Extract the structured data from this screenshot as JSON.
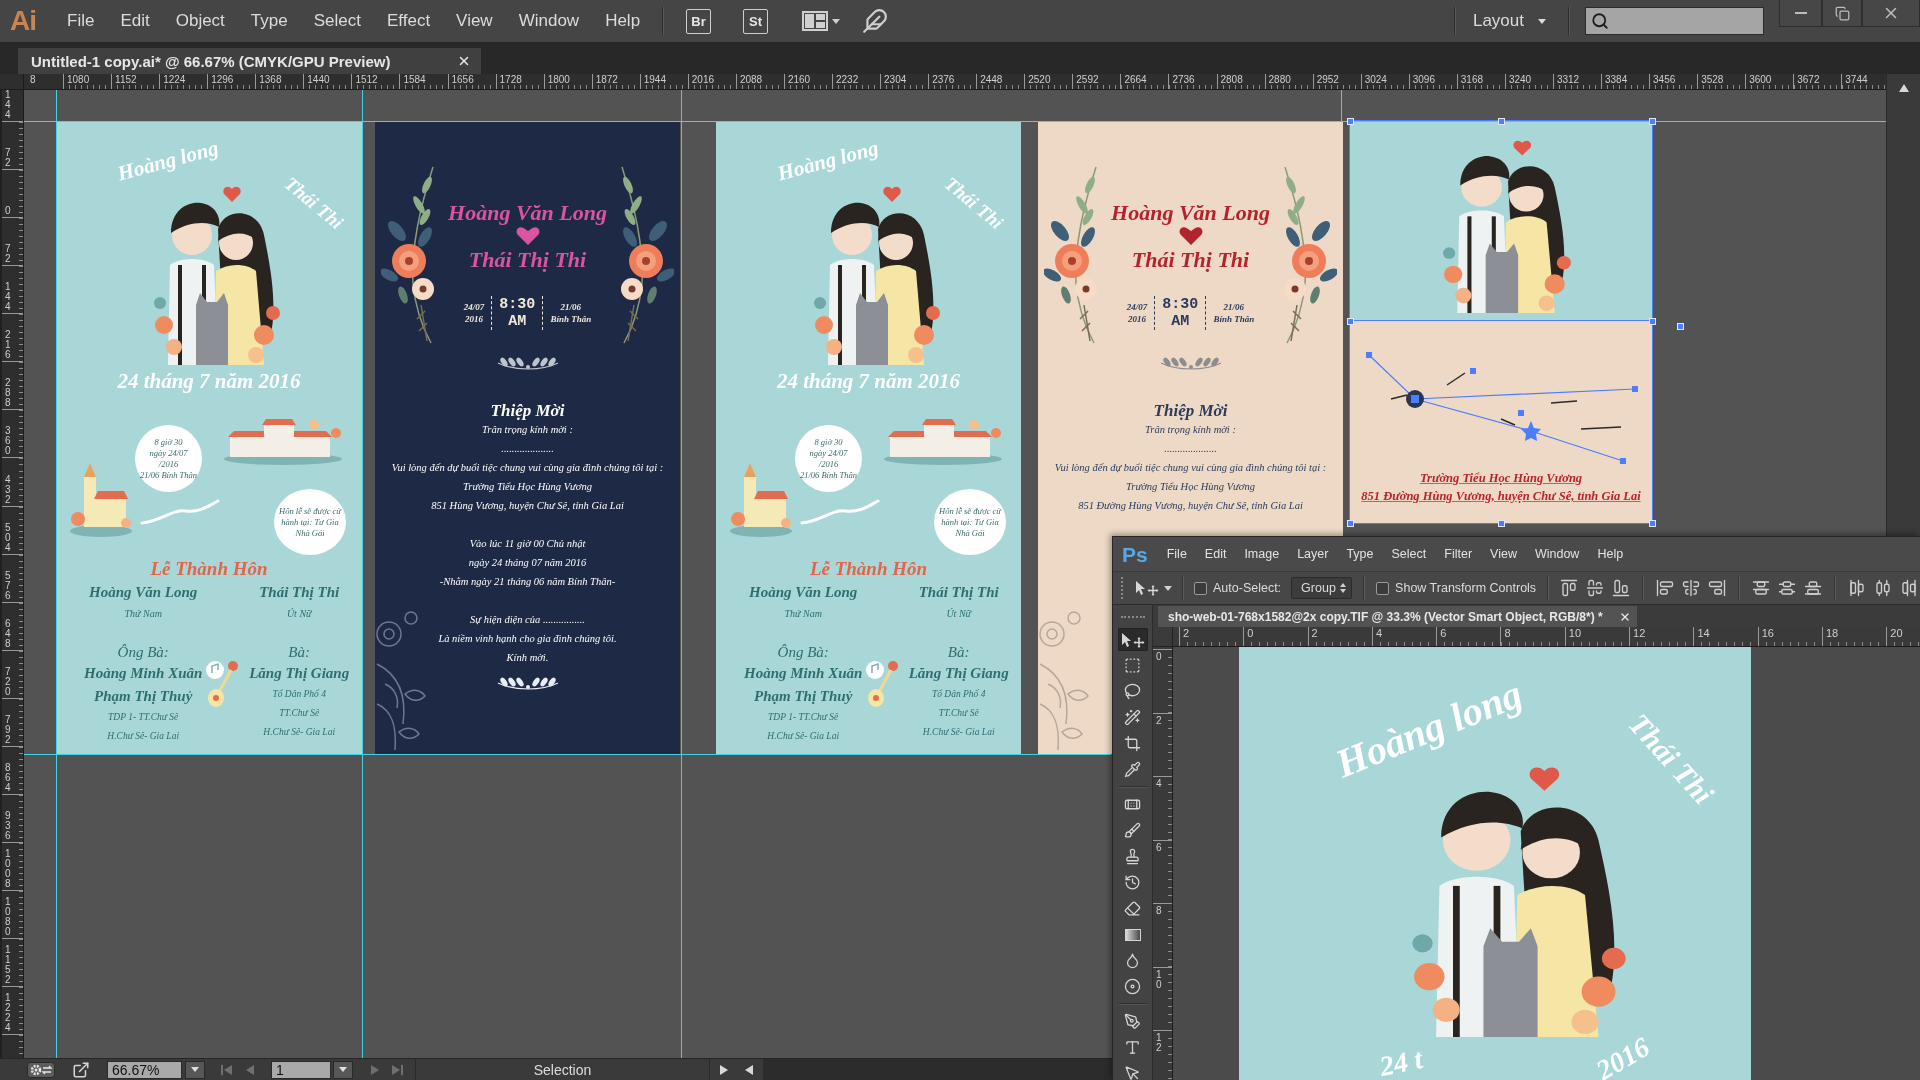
{
  "menu_bar": {
    "logo": "Ai",
    "menus": [
      "File",
      "Edit",
      "Object",
      "Type",
      "Select",
      "Effect",
      "View",
      "Window",
      "Help"
    ],
    "bridge": "Br",
    "stock": "St",
    "workspace": "Layout"
  },
  "document_tab": {
    "title": "Untitled-1 copy.ai* @ 66.67% (CMYK/GPU Preview)"
  },
  "horizontal_ruler": [
    "8",
    "1080",
    "1152",
    "1224",
    "1296",
    "1368",
    "1440",
    "1512",
    "1584",
    "1656",
    "1728",
    "1800",
    "1872",
    "1944",
    "2016",
    "2088",
    "2160",
    "2232",
    "2304",
    "2376",
    "2448",
    "2520",
    "2592",
    "2664",
    "2736",
    "2808",
    "2880",
    "2952",
    "3024",
    "3096",
    "3168",
    "3240",
    "3312",
    "3384",
    "3456",
    "3528",
    "3600",
    "3672",
    "3744"
  ],
  "vertical_ruler": [
    "144",
    "72",
    "0",
    "72",
    "144",
    "216",
    "288",
    "360",
    "432",
    "504",
    "576",
    "648",
    "720",
    "792",
    "864",
    "936",
    "1008",
    "1080",
    "1152",
    "1224"
  ],
  "artboards": [
    {
      "kind": "couple",
      "selected": false,
      "color": "#a9d7d8",
      "names": [
        "Hoàng long",
        "Thái Thi"
      ],
      "date": "24 tháng 7 năm 2016",
      "time_bubble": [
        "8 giờ 30",
        "ngày 24/07 /2016",
        "21/06 Bính Thân"
      ],
      "venue_bubble": "Hôn lễ sẽ được cử hành tại: Tư Gia Nhà Gái",
      "heading": "Lễ Thành Hôn",
      "families": [
        {
          "name": "Hoàng Văn Long",
          "role": "Thứ Nam",
          "parents_title": "Ông Bà:",
          "parents": [
            "Hoàng Minh Xuân",
            "Phạm Thị Thuỷ"
          ],
          "address": [
            "TDP 1- TT.Chư Sê",
            "H.Chư Sê- Gia Lai"
          ]
        },
        {
          "name": "Thái Thị Thi",
          "role": "Út Nữ",
          "parents_title": "Bà:",
          "parents": [
            "Lăng Thị Giang"
          ],
          "address": [
            "Tổ Dân Phố 4",
            "TT.Chư Sê",
            "H.Chư Sê- Gia Lai"
          ]
        }
      ]
    },
    {
      "kind": "invitation",
      "selected": false,
      "color": "#1e2a45",
      "groom": "Hoàng Văn Long",
      "bride": "Thái Thị Thi",
      "date": [
        "24/07",
        "2016"
      ],
      "time": [
        "8:30",
        "AM"
      ],
      "lunar": [
        "21/06",
        "Bính Thân"
      ],
      "title": "Thiệp Mời",
      "blocks": [
        [
          "Trân trọng kính mời :",
          "....................",
          "Vui lòng đến dự buổi tiệc chung vui cùng gia đình chúng tôi tại :",
          "Trường Tiểu Học Hùng Vương",
          "851 Hùng Vương, huyện Chư Sê, tỉnh Gia Lai"
        ],
        [
          "Vào lúc 11 giờ 00 Chủ nhật",
          "ngày 24 tháng 07 năm 2016",
          "-Nhằm ngày 21 tháng 06 năm Bính Thân-"
        ],
        [
          "Sự hiện diện của ................",
          "Là niềm vinh hạnh cho gia đình chúng tôi.",
          "Kính mời."
        ]
      ],
      "closing_ornament": true
    },
    {
      "kind": "couple",
      "selected": false,
      "color": "#a9d7d8",
      "names": [
        "Hoàng long",
        "Thái Thi"
      ],
      "date": "24 tháng 7 năm 2016",
      "time_bubble": [
        "8 giờ 30",
        "ngày 24/07 /2016",
        "21/06 Bính Thân"
      ],
      "venue_bubble": "Hôn lễ sẽ được cử hành tại: Tư Gia Nhà Gái",
      "heading": "Lễ Thành Hôn",
      "families": [
        {
          "name": "Hoàng Văn Long",
          "role": "Thứ Nam",
          "parents_title": "Ông Bà:",
          "parents": [
            "Hoàng Minh Xuân",
            "Phạm Thị Thuỷ"
          ],
          "address": [
            "TDP 1- TT.Chư Sê",
            "H.Chư Sê- Gia Lai"
          ]
        },
        {
          "name": "Thái Thị Thi",
          "role": "Út Nữ",
          "parents_title": "Bà:",
          "parents": [
            "Lăng Thị Giang"
          ],
          "address": [
            "Tổ Dân Phố 4",
            "TT.Chư Sê",
            "H.Chư Sê- Gia Lai"
          ]
        }
      ]
    },
    {
      "kind": "invitation",
      "selected": false,
      "color": "#eed9c6",
      "groom": "Hoàng Văn Long",
      "bride": "Thái Thị Thi",
      "date": [
        "24/07",
        "2016"
      ],
      "time": [
        "8:30",
        "AM"
      ],
      "lunar": [
        "21/06",
        "Bính Thân"
      ],
      "title": "Thiệp Mời",
      "blocks": [
        [
          "Trân trọng kính mời :",
          "....................",
          "Vui lòng đến dự buổi tiệc chung vui cùng gia đình chúng tôi tại :",
          "Trường Tiểu Học Hùng Vương",
          "851 Đường Hùng Vương, huyện Chư Sê, tỉnh Gia Lai"
        ]
      ],
      "closing_ornament": false
    },
    {
      "kind": "map",
      "selected": true,
      "color": "#eed9c6",
      "address": [
        "Trường Tiểu Học Hùng Vương",
        "851 Đường Hùng Vương, huyện Chư Sê, tỉnh Gia Lai"
      ]
    }
  ],
  "photoshop_window": {
    "logo": "Ps",
    "menus": [
      "File",
      "Edit",
      "Image",
      "Layer",
      "Type",
      "Select",
      "Filter",
      "View",
      "Window",
      "Help"
    ],
    "auto_select": {
      "label": "Auto-Select:",
      "checked": false
    },
    "auto_select_target": "Group",
    "transform_controls": {
      "label": "Show Transform Controls",
      "checked": false
    },
    "tools": [
      {
        "selected": true
      },
      {
        "selected": false
      },
      {
        "selected": false
      },
      {
        "selected": false
      },
      {
        "selected": false
      },
      {
        "selected": false
      },
      {
        "selected": false
      },
      {
        "selected": false
      },
      {
        "selected": false
      },
      {
        "selected": false
      },
      {
        "selected": false
      },
      {
        "selected": false
      },
      {
        "selected": false
      },
      {
        "selected": false
      },
      {
        "selected": false
      },
      {
        "selected": false
      },
      {
        "selected": false
      }
    ],
    "document_tab": {
      "title": "sho-web-01-768x1582@2x copy.TIF @ 33.3% (Vector Smart Object, RGB/8*) *"
    },
    "horizontal_ruler": [
      "2",
      "0",
      "2",
      "4",
      "6",
      "8",
      "10",
      "12",
      "14",
      "16",
      "18",
      "20"
    ],
    "vertical_ruler": [
      "0",
      "2",
      "4",
      "6",
      "8",
      "10",
      "12"
    ],
    "image": {
      "names": [
        "Hoàng long",
        "Thái Thi"
      ],
      "date": [
        "24 t",
        "2016"
      ]
    }
  },
  "status_bar": {
    "zoom": "66.67%",
    "page": "1",
    "tool": "Selection"
  }
}
